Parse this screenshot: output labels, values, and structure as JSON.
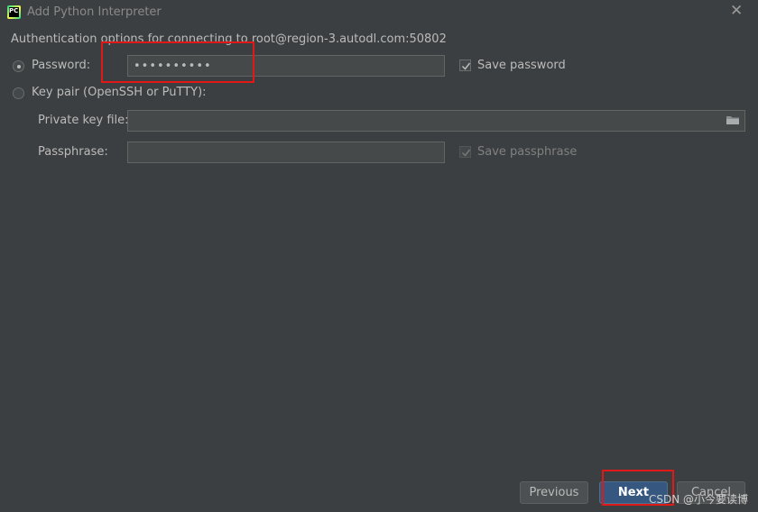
{
  "window": {
    "title": "Add Python Interpreter",
    "icon_text": "PC"
  },
  "auth": {
    "heading": "Authentication options for connecting to root@region-3.autodl.com:50802",
    "selected_option": "password",
    "password_label": "Password:",
    "password_value": "••••••••••",
    "save_password_label": "Save password",
    "save_password_checked": true,
    "keypair_label": "Key pair (OpenSSH or PuTTY):",
    "private_key_label": "Private key file:",
    "private_key_value": "",
    "passphrase_label": "Passphrase:",
    "passphrase_value": "",
    "save_passphrase_label": "Save passphrase",
    "save_passphrase_checked": true,
    "save_passphrase_enabled": false
  },
  "footer": {
    "previous_label": "Previous",
    "next_label": "Next",
    "cancel_label": "Cancel"
  },
  "watermark": "CSDN @小今要读博",
  "colors": {
    "background": "#3c3f41",
    "highlight": "#e01818",
    "primary_button": "#365880"
  },
  "icons": {
    "close": "close-icon",
    "folder": "folder-icon",
    "app": "pycharm-icon"
  }
}
